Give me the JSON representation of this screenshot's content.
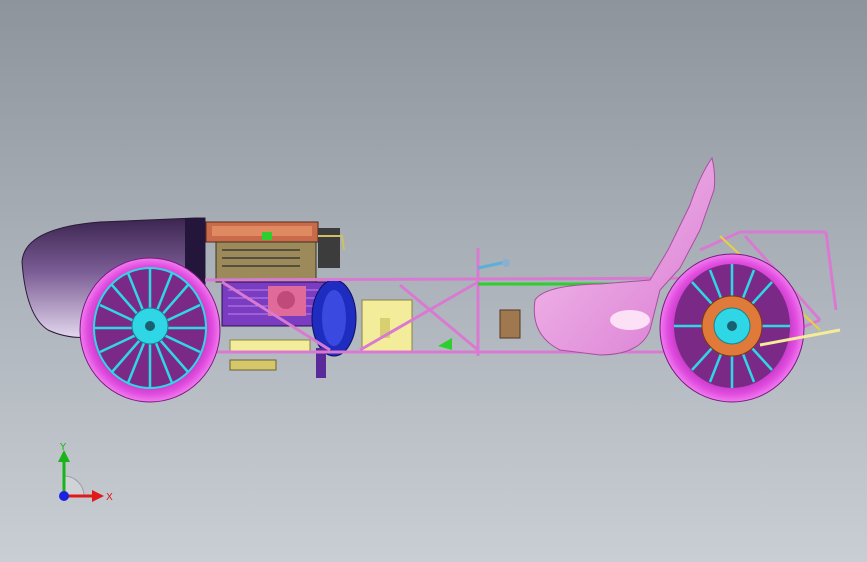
{
  "triad": {
    "x_label": "X",
    "y_label": "Y"
  },
  "colors": {
    "tire": "#e24ee0",
    "rim": "#2fd7e6",
    "frame": "#e08be6",
    "nose": "#5c3f78",
    "engine": "#c96a4a",
    "seat": "#f2a8e8",
    "green_rail": "#2fce2f",
    "yellow": "#f3ec9a",
    "x_axis": "#e01a1a",
    "y_axis": "#1ab31a",
    "origin": "#1a22e0"
  }
}
